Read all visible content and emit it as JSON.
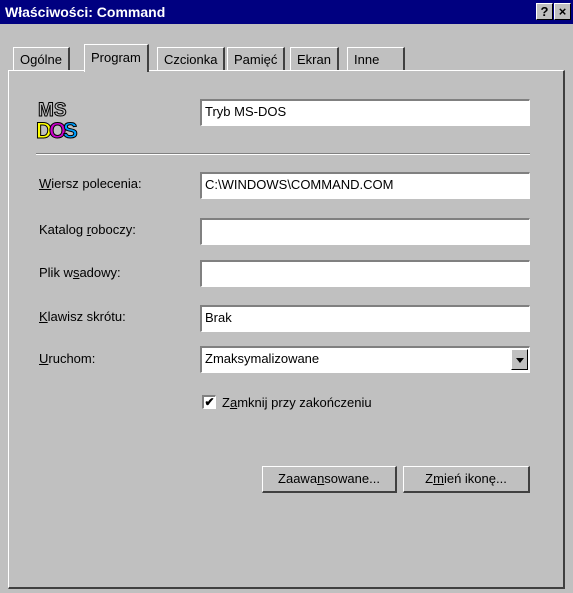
{
  "window": {
    "title": "Właściwości: Command",
    "help_glyph": "?",
    "close_glyph": "×"
  },
  "tabs": [
    {
      "label": "Ogólne"
    },
    {
      "label": "Program"
    },
    {
      "label": "Czcionka"
    },
    {
      "label": "Pamięć"
    },
    {
      "label": "Ekran"
    },
    {
      "label": "Inne"
    }
  ],
  "active_tab": "Program",
  "program": {
    "icon": "ms-dos-icon",
    "name_value": "Tryb MS-DOS",
    "command_line": {
      "label_u": "W",
      "label_rest": "iersz polecenia:",
      "value": "C:\\WINDOWS\\COMMAND.COM"
    },
    "working_dir": {
      "label_pre": "Katalog ",
      "label_u": "r",
      "label_rest": "oboczy:",
      "value": ""
    },
    "batch_file": {
      "label_pre": "Plik w",
      "label_u": "s",
      "label_rest": "adowy:",
      "value": ""
    },
    "shortcut_key": {
      "label_u": "K",
      "label_rest": "lawisz skrótu:",
      "value": "Brak"
    },
    "run": {
      "label_u": "U",
      "label_rest": "ruchom:",
      "value": "Zmaksymalizowane"
    },
    "close_on_exit": {
      "checked": true,
      "check_glyph": "✔",
      "label_pre": "Z",
      "label_u": "a",
      "label_rest": "mknij przy zakończeniu"
    },
    "advanced_button": {
      "label_pre": "Zaawa",
      "label_u": "n",
      "label_rest": "sowane..."
    },
    "change_icon_button": {
      "label_pre": "Z",
      "label_u": "m",
      "label_rest": "ień ikonę..."
    }
  },
  "colors": {
    "titlebar": "#000080",
    "face": "#c0c0c0"
  }
}
